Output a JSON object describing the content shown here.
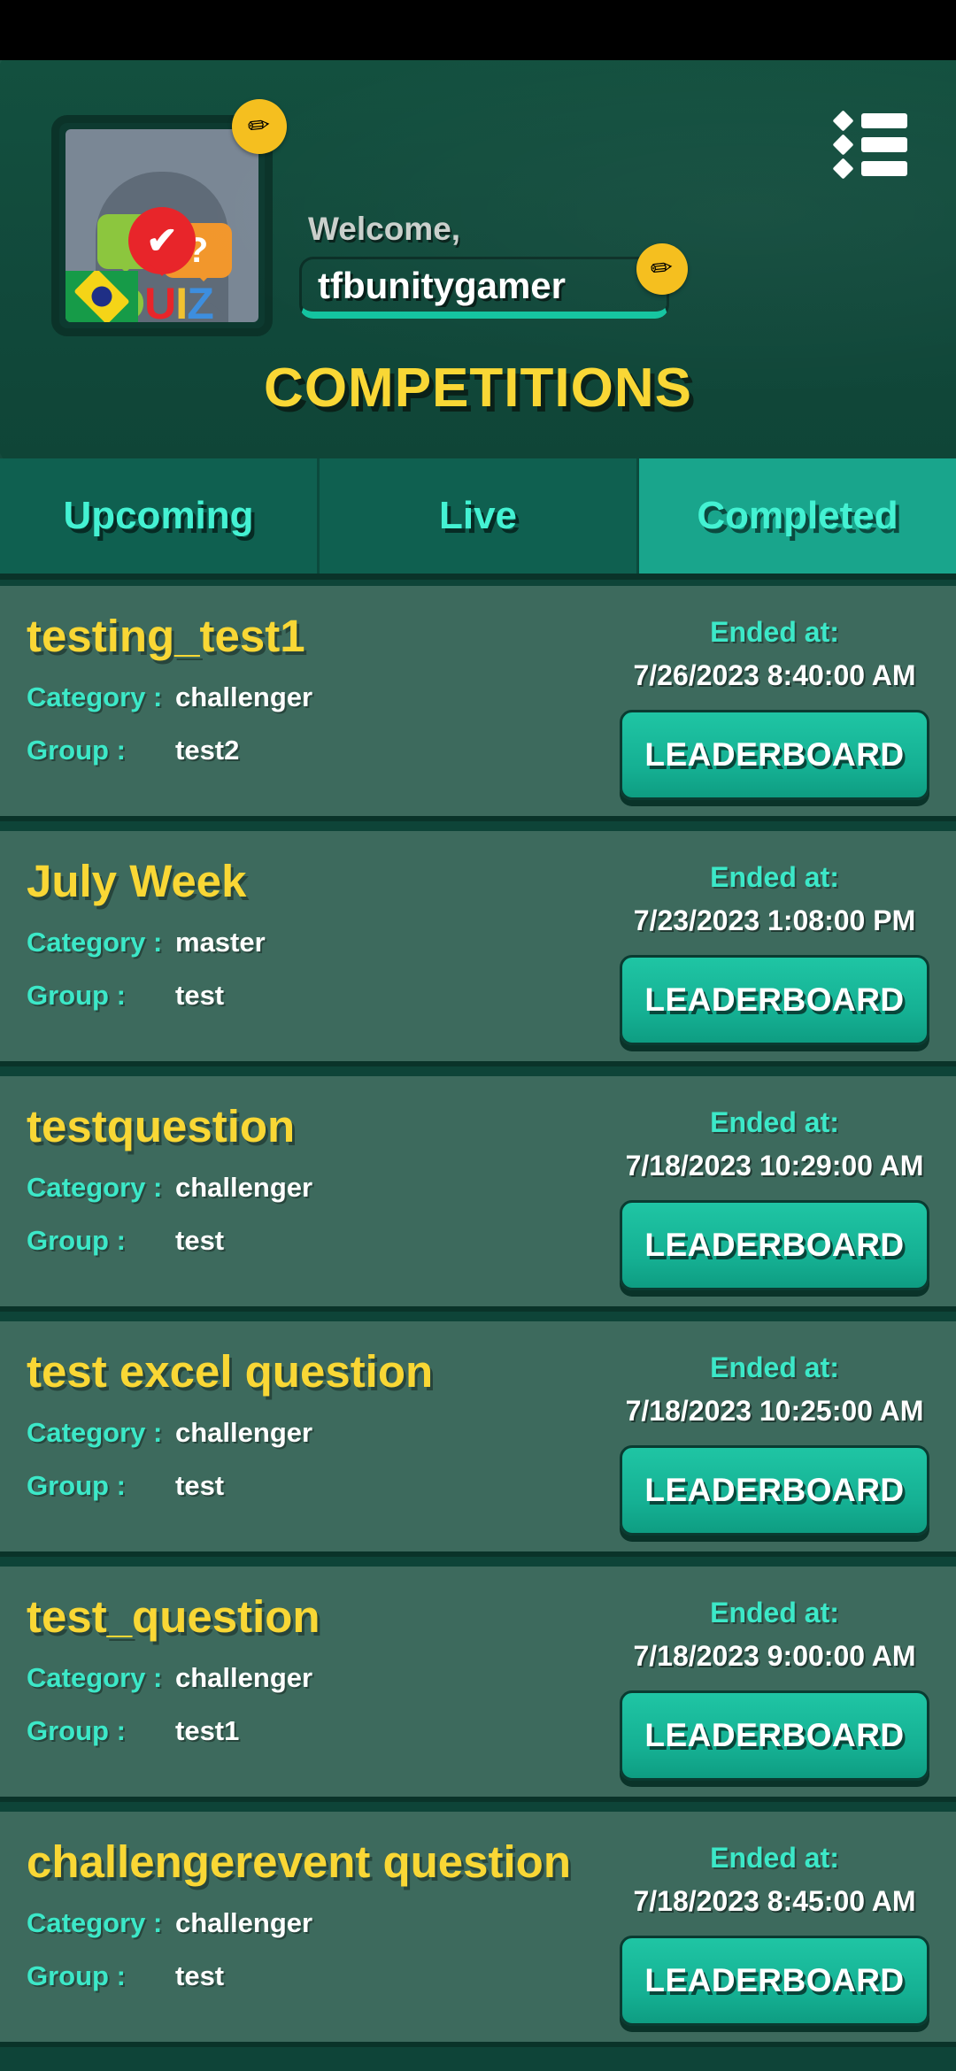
{
  "status_bar": {
    "present": true
  },
  "header": {
    "welcome_label": "Welcome,",
    "username": "tfbunitygamer",
    "avatar": {
      "quiz_text": {
        "q": "Q",
        "u": "U",
        "i": "I",
        "z": "Z"
      },
      "green_bubble_mark": "!",
      "orange_bubble_mark": "?",
      "check_mark": "✔",
      "flag_name": "brazil-flag"
    },
    "edit_avatar_icon": "✏",
    "edit_name_icon": "✏",
    "menu_icon": "list-menu-icon",
    "page_title": "COMPETITIONS"
  },
  "tabs": [
    {
      "label": "Upcoming",
      "active": false
    },
    {
      "label": "Live",
      "active": false
    },
    {
      "label": "Completed",
      "active": true
    }
  ],
  "labels": {
    "category": "Category :",
    "group": "Group :",
    "ended_at": "Ended at:",
    "leaderboard": "LEADERBOARD"
  },
  "colors": {
    "background": "#0e4438",
    "header_green": "#13503f",
    "card_bg": "#3d6a5d",
    "tab_inactive": "#0f6050",
    "tab_active": "#19a58c",
    "title_yellow": "#f9d735",
    "accent_teal": "#3ce8c8",
    "button_teal": "#15b093",
    "badge_yellow": "#f5bf1f"
  },
  "competitions": [
    {
      "title": "testing_test1",
      "category": "challenger",
      "group": "test2",
      "ended_at": "7/26/2023 8:40:00 AM"
    },
    {
      "title": "July Week",
      "category": "master",
      "group": "test",
      "ended_at": "7/23/2023 1:08:00 PM"
    },
    {
      "title": "testquestion",
      "category": "challenger",
      "group": "test",
      "ended_at": "7/18/2023 10:29:00 AM"
    },
    {
      "title": "test excel question",
      "category": "challenger",
      "group": "test",
      "ended_at": "7/18/2023 10:25:00 AM"
    },
    {
      "title": "test_question",
      "category": "challenger",
      "group": "test1",
      "ended_at": "7/18/2023 9:00:00 AM"
    },
    {
      "title": "challengerevent question",
      "category": "challenger",
      "group": "test",
      "ended_at": "7/18/2023 8:45:00 AM"
    }
  ]
}
